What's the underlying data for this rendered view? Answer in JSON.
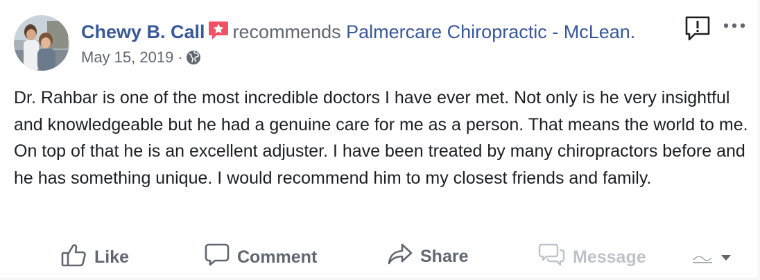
{
  "post": {
    "author": "Chewy B. Call",
    "recommends_text": "recommends",
    "page_name": "Palmercare Chiropractic - McLean.",
    "date": "May 15, 2019",
    "separator": "·",
    "body": "Dr. Rahbar is one of the most incredible doctors I have ever met. Not only is he very insightful and knowledgeable but he had a genuine care for me as a person. That means the world to me. On top of that he is an excellent adjuster. I have been treated by many chiropractors before and he has something unique. I would recommend him to my closest friends and family."
  },
  "actions": {
    "like": "Like",
    "comment": "Comment",
    "share": "Share",
    "message": "Message"
  },
  "icons": {
    "recommend_badge": "recommend-star-icon",
    "privacy": "globe-icon",
    "report": "report-flag-icon",
    "more": "more-options-icon",
    "like": "thumbs-up-icon",
    "comment": "speech-bubble-icon",
    "share": "share-arrow-icon",
    "message": "message-bubbles-icon",
    "page_selector": "chevron-down-icon"
  },
  "colors": {
    "link_blue": "#385898",
    "secondary_text": "#606770",
    "badge_red": "#f25268",
    "disabled": "#bec3c9"
  }
}
